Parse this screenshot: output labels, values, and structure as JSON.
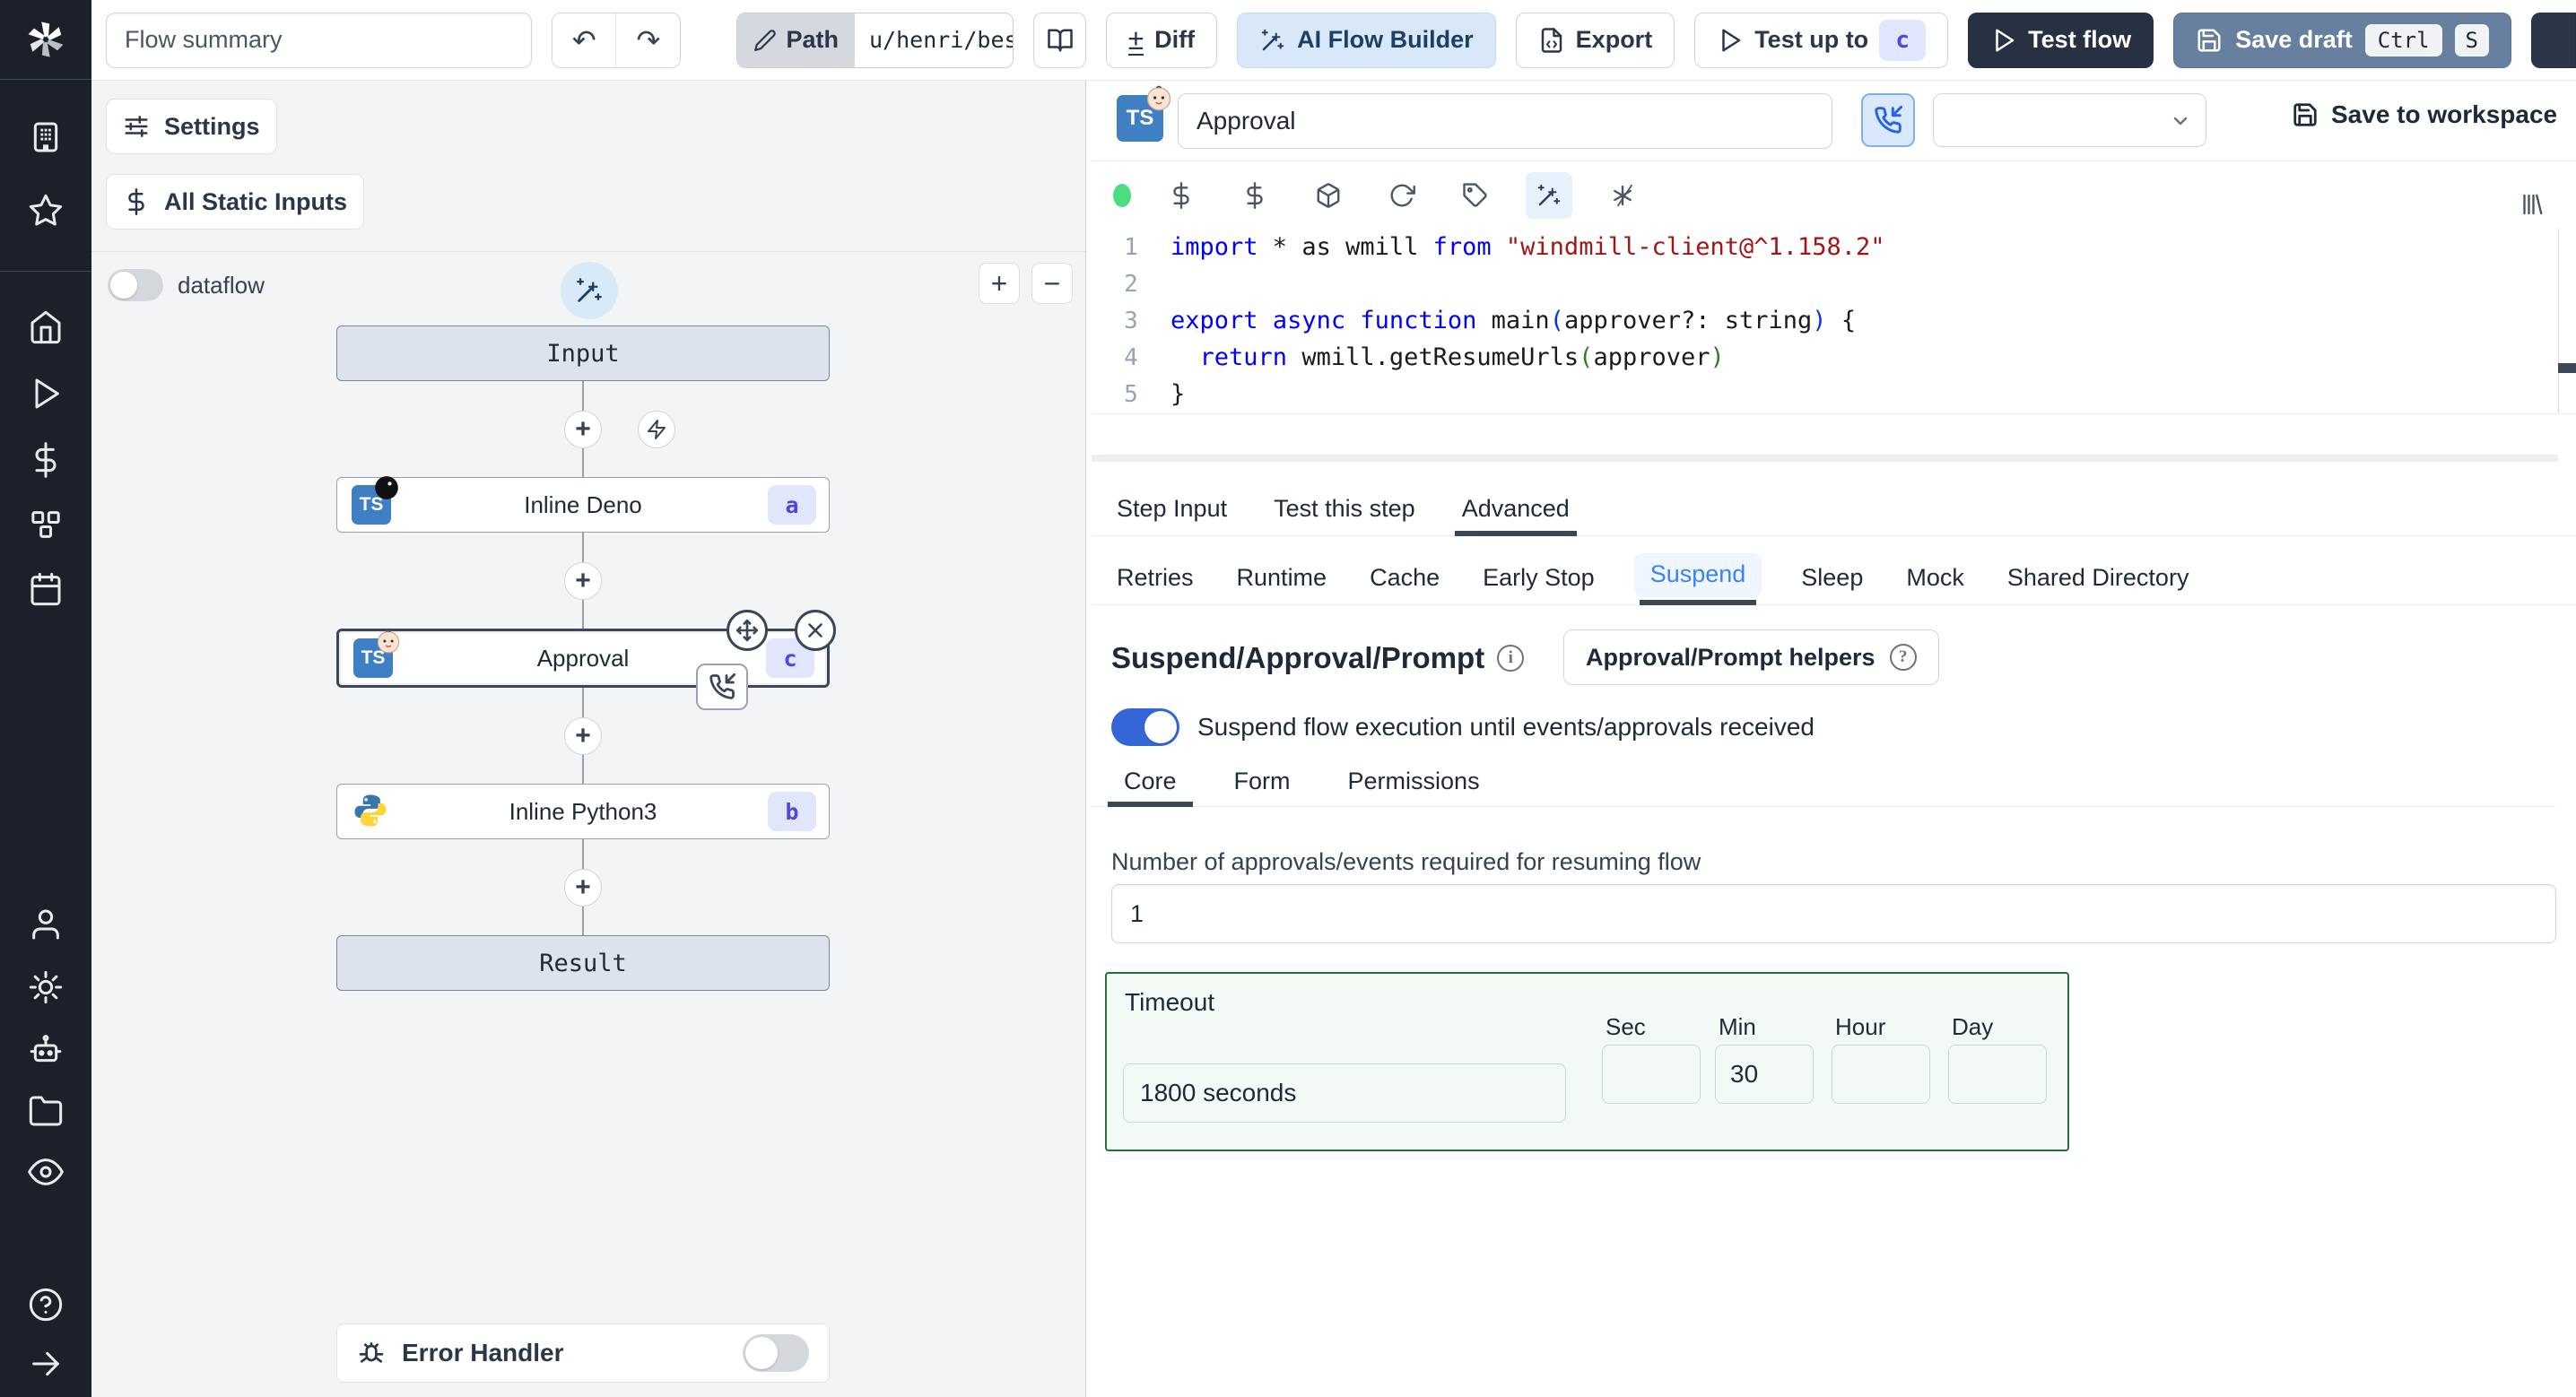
{
  "colors": {
    "sidebar_bg": "#1b202b",
    "accent_blue": "#3566d8",
    "indigo_badge_bg": "#e2e6fc",
    "indigo_badge_text": "#4f46e5",
    "ai_button_bg": "#d8e8f8",
    "dark_button_bg": "#273142",
    "save_draft_bg": "#68809f",
    "timeout_border": "#2d6b3c",
    "suspend_tab_text": "#3b82f6",
    "status_dot": "#4ade80",
    "selected_node_border": "#3b4656"
  },
  "icons": {
    "sidebar": [
      "windmill-logo",
      "building-icon",
      "star-icon",
      "home-icon",
      "play-icon",
      "dollar-icon",
      "resources-icon",
      "calendar-icon",
      "user-icon",
      "gear-icon",
      "robot-icon",
      "folder-icon",
      "eye-icon",
      "help-icon",
      "arrow-right-icon"
    ],
    "editor_toolbar": [
      "status-dot",
      "dollar-icon",
      "dollar-icon",
      "package-icon",
      "refresh-icon",
      "tag-icon",
      "wand-icon",
      "asterisk-icon",
      "library-icon"
    ]
  },
  "topbar": {
    "flow_summary_placeholder": "Flow summary",
    "path_label": "Path",
    "path_value": "u/henri/bes",
    "undo_glyph": "↶",
    "redo_glyph": "↷",
    "diff_label": "Diff",
    "diff_glyph": "±",
    "ai_flow_builder_label": "AI Flow Builder",
    "export_label": "Export",
    "test_up_to_label": "Test up to",
    "test_up_to_badge": "c",
    "test_flow_label": "Test flow",
    "save_draft_label": "Save draft",
    "save_draft_kbd": [
      "Ctrl",
      "S"
    ]
  },
  "flow_panel": {
    "settings_label": "Settings",
    "static_inputs_label": "All Static Inputs",
    "dataflow_label": "dataflow",
    "zoom_in_glyph": "+",
    "zoom_out_glyph": "−",
    "error_handler_label": "Error Handler",
    "nodes": [
      {
        "label": "Input",
        "kind": "virtual"
      },
      {
        "label": "Inline Deno",
        "kind": "script",
        "lang": "deno",
        "badge": "a"
      },
      {
        "label": "Approval",
        "kind": "script",
        "lang": "approval",
        "badge": "c",
        "selected": true
      },
      {
        "label": "Inline Python3",
        "kind": "script",
        "lang": "python",
        "badge": "b"
      },
      {
        "label": "Result",
        "kind": "virtual"
      }
    ]
  },
  "step_panel": {
    "name_value": "Approval",
    "save_to_workspace_label": "Save to workspace",
    "code": {
      "lines": [
        {
          "n": "1",
          "tokens": [
            {
              "c": "kw",
              "t": "import"
            },
            {
              "c": "pl",
              "t": " * as wmill "
            },
            {
              "c": "kw",
              "t": "from"
            },
            {
              "c": "str",
              "t": " \"windmill-client@^1.158.2\""
            }
          ]
        },
        {
          "n": "2",
          "tokens": []
        },
        {
          "n": "3",
          "tokens": [
            {
              "c": "kw",
              "t": "export"
            },
            {
              "c": "pl",
              "t": " "
            },
            {
              "c": "kw",
              "t": "async"
            },
            {
              "c": "pl",
              "t": " "
            },
            {
              "c": "kw",
              "t": "function"
            },
            {
              "c": "pl",
              "t": " main"
            },
            {
              "c": "pb",
              "t": "("
            },
            {
              "c": "pl",
              "t": "approver?: string"
            },
            {
              "c": "pb",
              "t": ")"
            },
            {
              "c": "pl",
              "t": " {"
            }
          ]
        },
        {
          "n": "4",
          "tokens": [
            {
              "c": "pl",
              "t": "  "
            },
            {
              "c": "kw",
              "t": "return"
            },
            {
              "c": "pl",
              "t": " wmill.getResumeUrls"
            },
            {
              "c": "pg",
              "t": "("
            },
            {
              "c": "pl",
              "t": "approver"
            },
            {
              "c": "pg",
              "t": ")"
            }
          ]
        },
        {
          "n": "5",
          "tokens": [
            {
              "c": "pl",
              "t": "}"
            }
          ]
        }
      ]
    },
    "primary_tabs": [
      "Step Input",
      "Test this step",
      "Advanced"
    ],
    "primary_active": "Advanced",
    "secondary_tabs": [
      "Retries",
      "Runtime",
      "Cache",
      "Early Stop",
      "Suspend",
      "Sleep",
      "Mock",
      "Shared Directory"
    ],
    "secondary_active": "Suspend",
    "suspend": {
      "title": "Suspend/Approval/Prompt",
      "info_glyph": "i",
      "helpers_label": "Approval/Prompt helpers",
      "helpers_glyph": "?",
      "toggle_label": "Suspend flow execution until events/approvals received",
      "sub_tabs": [
        "Core",
        "Form",
        "Permissions"
      ],
      "sub_active": "Core",
      "approvals_label": "Number of approvals/events required for resuming flow",
      "approvals_value": "1",
      "timeout_label": "Timeout",
      "timeout_value": "1800 seconds",
      "units": [
        {
          "label": "Sec",
          "value": ""
        },
        {
          "label": "Min",
          "value": "30"
        },
        {
          "label": "Hour",
          "value": ""
        },
        {
          "label": "Day",
          "value": ""
        }
      ]
    }
  }
}
